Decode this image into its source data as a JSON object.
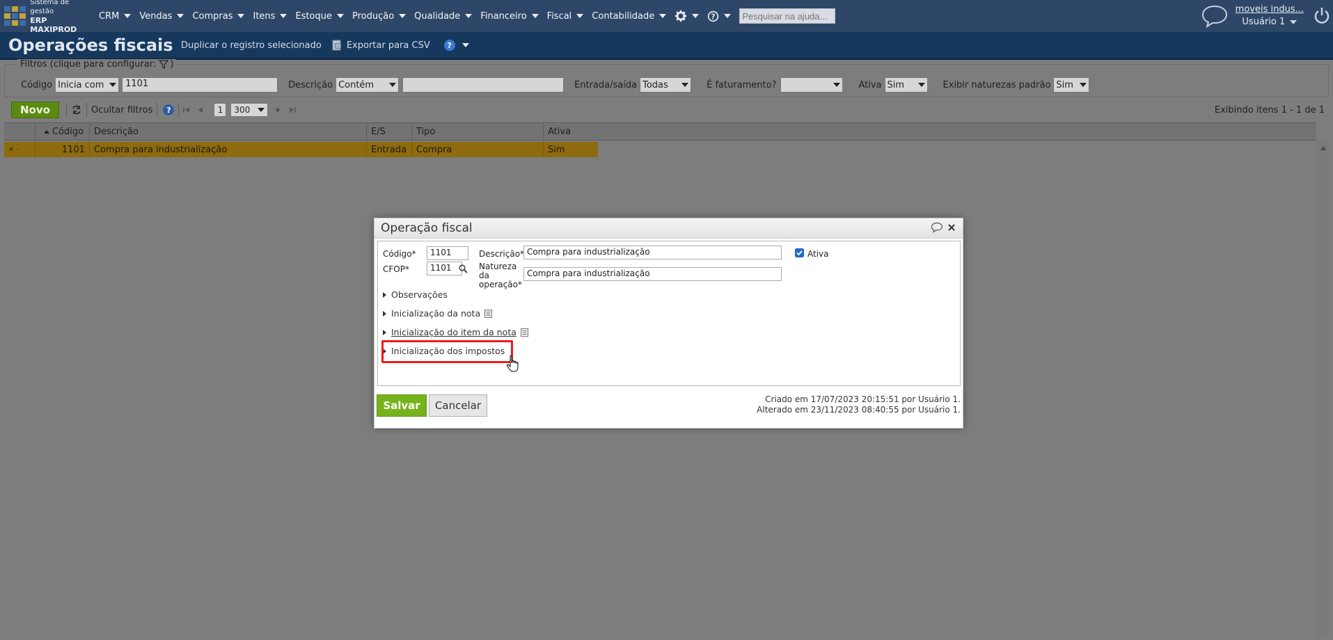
{
  "nav": {
    "logo_line1": "Sistema de gestão",
    "logo_line2": "ERP MAXIPROD",
    "menu": [
      "CRM",
      "Vendas",
      "Compras",
      "Itens",
      "Estoque",
      "Produção",
      "Qualidade",
      "Financeiro",
      "Fiscal",
      "Contabilidade"
    ],
    "search_placeholder": "Pesquisar na ajuda...",
    "company": "moveis indus...",
    "user": "Usuário 1",
    "icons": [
      "gear-icon",
      "help-icon",
      "chat-icon",
      "power-icon"
    ]
  },
  "titlebar": {
    "title": "Operações fiscais",
    "duplicate": "Duplicar o registro selecionado",
    "export": "Exportar para CSV",
    "help_glyph": "?"
  },
  "filters": {
    "legend": "Filtros (clique para configurar:",
    "legend_end": ")",
    "codigo_label": "Código",
    "codigo_op": "Inicia com",
    "codigo_value": "1101",
    "descricao_label": "Descrição",
    "descricao_op": "Contém",
    "descricao_value": "",
    "es_label": "Entrada/saída",
    "es_value": "Todas",
    "fat_label": "É faturamento?",
    "fat_value": "",
    "ativa_label": "Ativa",
    "ativa_value": "Sim",
    "nat_label": "Exibir naturezas padrão",
    "nat_value": "Sim"
  },
  "toolbar": {
    "novo": "Novo",
    "hide_filters": "Ocultar filtros",
    "page": "1",
    "page_size": "300",
    "showing": "Exibindo itens 1 - 1 de 1"
  },
  "grid": {
    "columns": [
      "Código",
      "Descrição",
      "E/S",
      "Tipo",
      "Ativa"
    ],
    "rows": [
      {
        "codigo": "1101",
        "descricao": "Compra para industrialização",
        "es": "Entrada",
        "tipo": "Compra",
        "ativa": "Sim"
      }
    ]
  },
  "dialog": {
    "title": "Operação fiscal",
    "codigo_label": "Código*",
    "codigo_value": "1101",
    "cfop_label": "CFOP*",
    "cfop_value": "1101",
    "descricao_label": "Descrição*",
    "descricao_value": "Compra para industrialização",
    "natureza_label_1": "Natureza",
    "natureza_label_2": "da",
    "natureza_label_3": "operação*",
    "natureza_value": "Compra para industrialização",
    "ativa_label": "Ativa",
    "ativa_checked": true,
    "sections": [
      "Observações",
      "Inicialização da nota",
      "Inicialização do item da nota",
      "Inicialização dos impostos"
    ],
    "save": "Salvar",
    "cancel": "Cancelar",
    "created": "Criado em 17/07/2023 20:15:51 por Usuário 1.",
    "altered": "Alterado em 23/11/2023 08:40:55 por Usuário 1."
  },
  "colors": {
    "nav_bg": "#2e4768",
    "title_bg": "#16385d",
    "save_green": "#76b31b",
    "novo_green": "#5a8a12",
    "row_highlight": "#8d6b0e",
    "annotation_red": "#ee1b1b"
  }
}
